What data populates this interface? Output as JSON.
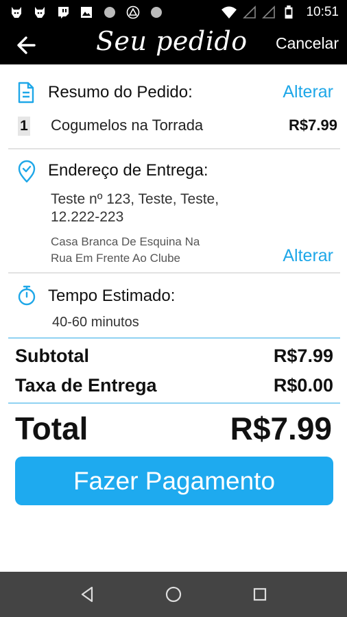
{
  "status_bar": {
    "time": "10:51",
    "icons": [
      "dog-icon",
      "dog-icon",
      "twitch-icon",
      "image-icon",
      "circle-icon",
      "triangle-icon",
      "circle-icon",
      "wifi-icon",
      "signal-icon",
      "signal-icon",
      "battery-icon"
    ]
  },
  "header": {
    "title": "Seu pedido",
    "cancel_label": "Cancelar",
    "back_icon": "arrow-left-icon"
  },
  "order_summary": {
    "title": "Resumo do Pedido:",
    "edit_label": "Alterar",
    "icon": "document-icon",
    "items": [
      {
        "qty": "1",
        "name": "Cogumelos na Torrada",
        "price": "R$7.99"
      }
    ]
  },
  "delivery_address": {
    "title": "Endereço de Entrega:",
    "icon": "location-pin-icon",
    "line1": "Teste nº 123, Teste, Teste,",
    "line2": "12.222-223",
    "note_line1": "Casa Branca De Esquina Na",
    "note_line2": "Rua Em Frente Ao Clube",
    "edit_label": "Alterar"
  },
  "estimated_time": {
    "title": "Tempo Estimado:",
    "icon": "stopwatch-icon",
    "value": "40-60 minutos"
  },
  "totals": {
    "subtotal_label": "Subtotal",
    "subtotal_value": "R$7.99",
    "delivery_label": "Taxa de Entrega",
    "delivery_value": "R$0.00",
    "total_label": "Total",
    "total_value": "R$7.99"
  },
  "pay_button": {
    "label": "Fazer Pagamento"
  },
  "colors": {
    "accent": "#1eaaef",
    "link": "#1ea7e8",
    "bar": "#000000",
    "nav": "#444444"
  }
}
